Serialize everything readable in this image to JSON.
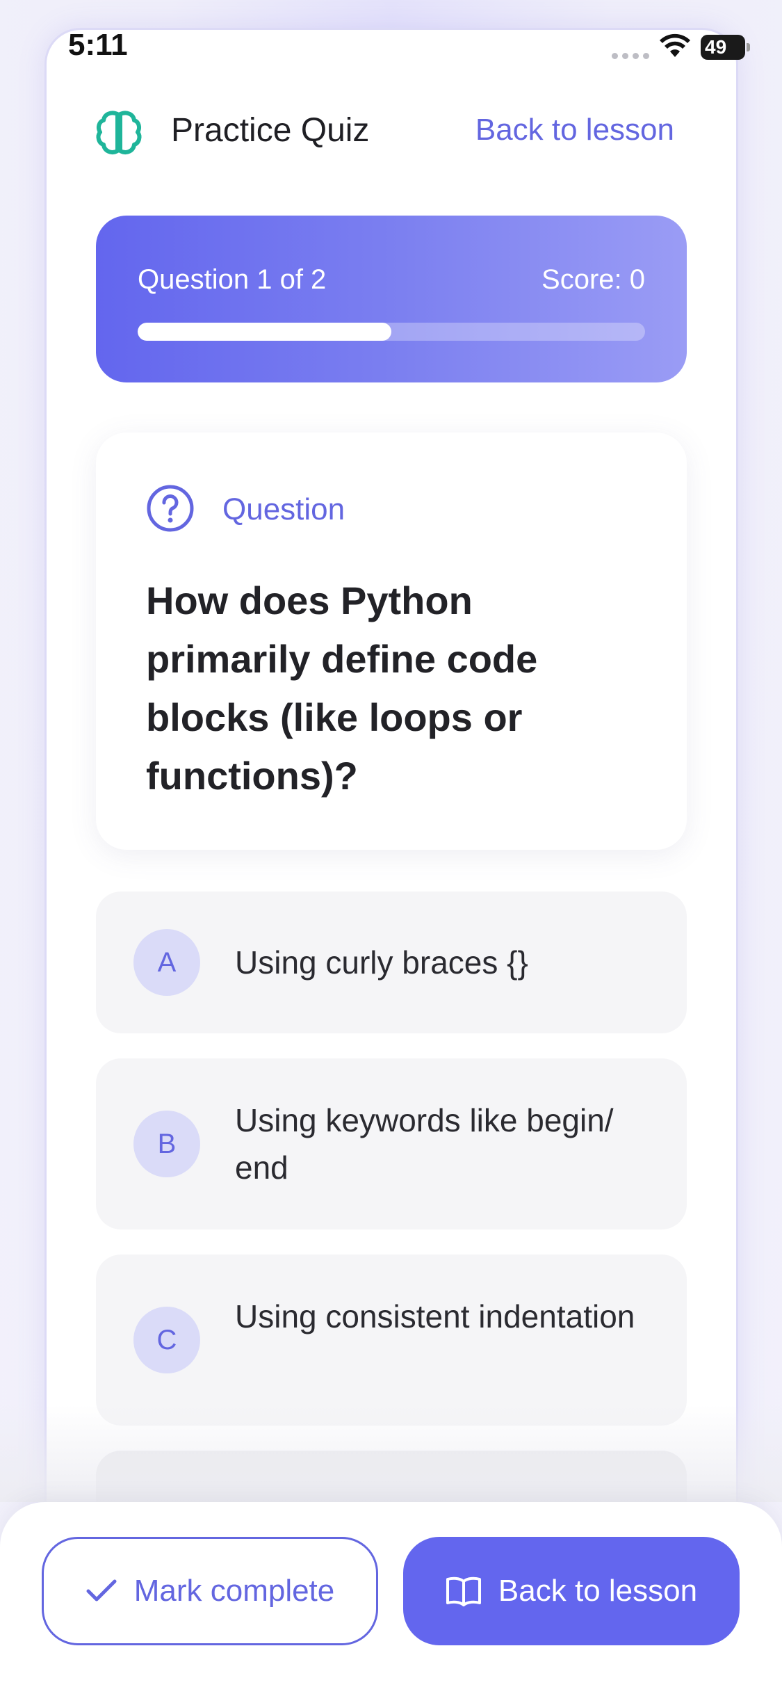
{
  "status_bar": {
    "time": "5:11",
    "battery": "49"
  },
  "header": {
    "title": "Practice Quiz",
    "back_link": "Back to lesson"
  },
  "progress": {
    "label": "Question 1 of 2",
    "score": "Score: 0",
    "fraction": 0.5
  },
  "question": {
    "label": "Question",
    "text": "How does Python primarily define code blocks (like loops or functions)?"
  },
  "options": [
    {
      "letter": "A",
      "text": "Using curly braces {}"
    },
    {
      "letter": "B",
      "text": "Using keywords like begin/ end"
    },
    {
      "letter": "C",
      "text": "Using consistent indentation"
    }
  ],
  "footer": {
    "mark_complete": "Mark complete",
    "back_to_lesson": "Back to lesson"
  },
  "colors": {
    "accent": "#6366EE",
    "brand_teal": "#1FB59A"
  }
}
